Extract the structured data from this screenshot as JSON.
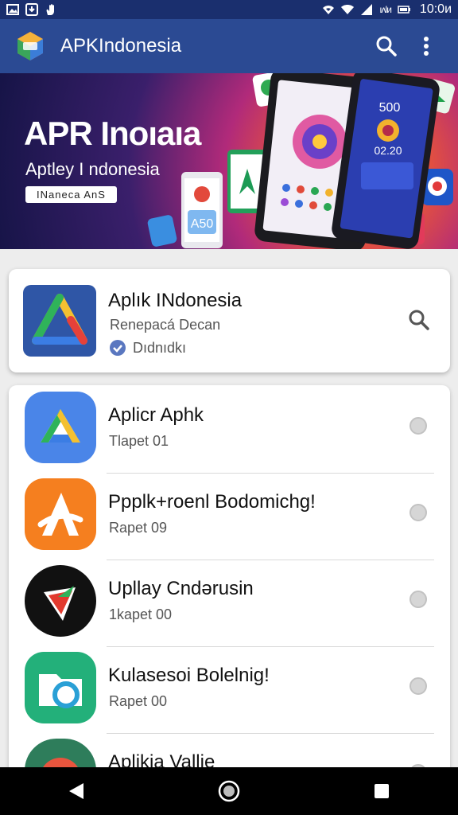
{
  "status_bar": {
    "time": "10:0ᴎ",
    "signal_text": "ıʌlᴎ",
    "icons": [
      "image-icon",
      "download-icon",
      "hand-icon",
      "wifi-signal-icon",
      "wifi-icon",
      "cell-signal-icon",
      "battery-icon"
    ]
  },
  "app_bar": {
    "title": "APKIndonesia",
    "logo_icon": "app-logo-icon",
    "actions": [
      "search-icon",
      "more-vert-icon"
    ],
    "color": "#2b4a93"
  },
  "banner": {
    "title": "APR Inoıaıa",
    "subtitle": "Aptley I ndonesia",
    "chip": "INaneca AnS",
    "phone_labels": {
      "left_app_badge": "A50",
      "right_phone_time": "500",
      "right_phone_counter": "02.20"
    }
  },
  "featured": {
    "title": "Aplık INdonesia",
    "subtitle": "Renepacá Decan",
    "badge_label": "Dıdnıdkı",
    "icon": "drive-triangle-icon",
    "action_icon": "search-icon"
  },
  "apps": [
    {
      "title": "Aplicr Aphk",
      "subtitle": "Tlapet 01",
      "icon": "drive-icon",
      "bg": "#4a85e8"
    },
    {
      "title": "Ppplk+roenl Bodomichg!",
      "subtitle": "Rapet 09",
      "icon": "letter-a-icon",
      "bg": "#f57f1f"
    },
    {
      "title": "Upllay Cndərusin",
      "subtitle": "1kapet 00",
      "icon": "play-shield-icon",
      "bg": "#111111"
    },
    {
      "title": "Kulasesoi Bolelnig!",
      "subtitle": "Rapet 00",
      "icon": "folder-sync-icon",
      "bg": "#23b07a"
    },
    {
      "title": "Aplikia Vallie",
      "subtitle": "",
      "icon": "ring-icon",
      "bg": "#2e7d5b"
    }
  ],
  "nav": [
    "back-icon",
    "home-icon",
    "recents-icon"
  ]
}
